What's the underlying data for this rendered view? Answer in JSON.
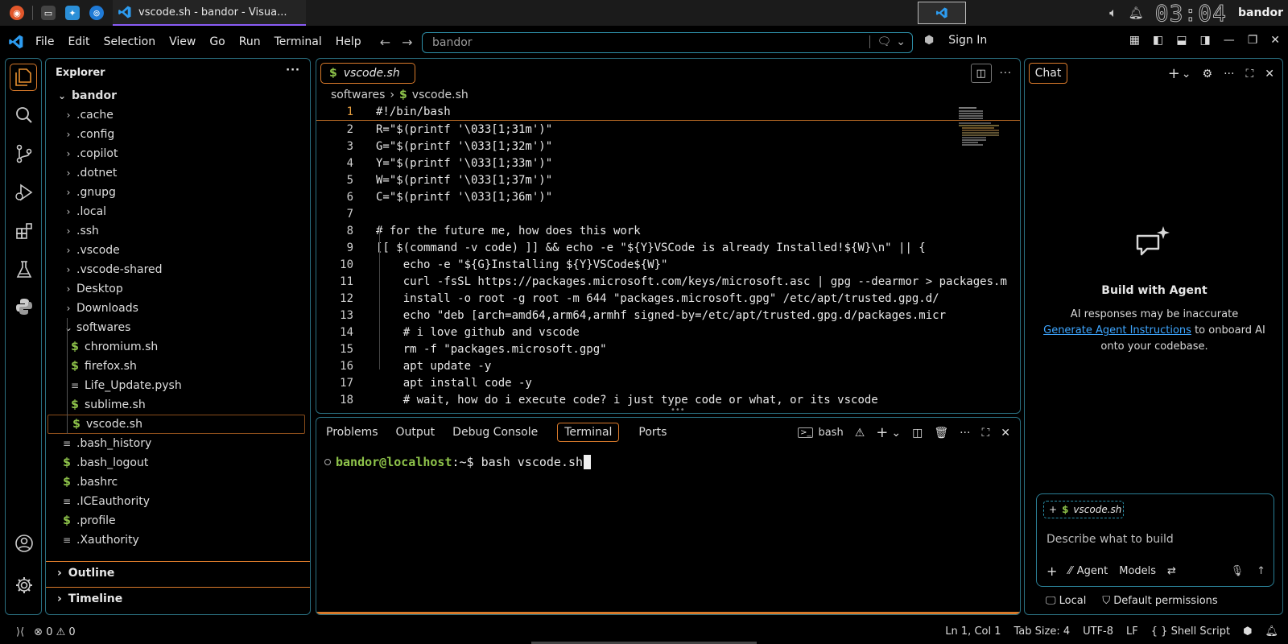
{
  "system": {
    "task_title": "vscode.sh - bandor - Visua...",
    "clock": "03:04",
    "user": "bandor"
  },
  "menu": [
    "File",
    "Edit",
    "Selection",
    "View",
    "Go",
    "Run",
    "Terminal",
    "Help"
  ],
  "command_center": {
    "text": "bandor"
  },
  "account": {
    "sign_in": "Sign In"
  },
  "explorer": {
    "title": "Explorer",
    "root": "bandor",
    "items": [
      {
        "label": ".cache",
        "type": "folder"
      },
      {
        "label": ".config",
        "type": "folder"
      },
      {
        "label": ".copilot",
        "type": "folder"
      },
      {
        "label": ".dotnet",
        "type": "folder"
      },
      {
        "label": ".gnupg",
        "type": "folder"
      },
      {
        "label": ".local",
        "type": "folder"
      },
      {
        "label": ".ssh",
        "type": "folder"
      },
      {
        "label": ".vscode",
        "type": "folder"
      },
      {
        "label": ".vscode-shared",
        "type": "folder"
      },
      {
        "label": "Desktop",
        "type": "folder"
      },
      {
        "label": "Downloads",
        "type": "folder"
      },
      {
        "label": "softwares",
        "type": "folder-open"
      },
      {
        "label": "chromium.sh",
        "type": "sh"
      },
      {
        "label": "firefox.sh",
        "type": "sh"
      },
      {
        "label": "Life_Update.pysh",
        "type": "txt"
      },
      {
        "label": "sublime.sh",
        "type": "sh"
      },
      {
        "label": "vscode.sh",
        "type": "sh"
      },
      {
        "label": ".bash_history",
        "type": "txt"
      },
      {
        "label": ".bash_logout",
        "type": "sh"
      },
      {
        "label": ".bashrc",
        "type": "sh"
      },
      {
        "label": ".ICEauthority",
        "type": "txt"
      },
      {
        "label": ".profile",
        "type": "sh"
      },
      {
        "label": ".Xauthority",
        "type": "txt"
      }
    ],
    "outline": "Outline",
    "timeline": "Timeline"
  },
  "editor": {
    "tab": "vscode.sh",
    "breadcrumb_folder": "softwares",
    "breadcrumb_file": "vscode.sh",
    "lines": [
      {
        "n": "1",
        "t": "#!/bin/bash",
        "cls": "cmt"
      },
      {
        "n": "2",
        "t": "R=\"$(printf '\\033[1;31m')\""
      },
      {
        "n": "3",
        "t": "G=\"$(printf '\\033[1;32m')\""
      },
      {
        "n": "4",
        "t": "Y=\"$(printf '\\033[1;33m')\""
      },
      {
        "n": "5",
        "t": "W=\"$(printf '\\033[1;37m')\""
      },
      {
        "n": "6",
        "t": "C=\"$(printf '\\033[1;36m')\""
      },
      {
        "n": "7",
        "t": ""
      },
      {
        "n": "8",
        "t": "# for the future me, how does this work",
        "cls": "cmt"
      },
      {
        "n": "9",
        "t": "[[ $(command -v code) ]] && echo -e \"${Y}VSCode is already Installed!${W}\\n\" || {"
      },
      {
        "n": "10",
        "t": "    echo -e \"${G}Installing ${Y}VSCode${W}\""
      },
      {
        "n": "11",
        "t": "    curl -fsSL https://packages.microsoft.com/keys/microsoft.asc | gpg --dearmor > packages.m"
      },
      {
        "n": "12",
        "t": "    install -o root -g root -m 644 \"packages.microsoft.gpg\" /etc/apt/trusted.gpg.d/"
      },
      {
        "n": "13",
        "t": "    echo \"deb [arch=amd64,arm64,armhf signed-by=/etc/apt/trusted.gpg.d/packages.micr"
      },
      {
        "n": "14",
        "t": "    # i love github and vscode",
        "cls": "cmt"
      },
      {
        "n": "15",
        "t": "    rm -f \"packages.microsoft.gpg\""
      },
      {
        "n": "16",
        "t": "    apt update -y"
      },
      {
        "n": "17",
        "t": "    apt install code -y"
      },
      {
        "n": "18",
        "t": "    # wait, how do i execute code? i just type code or what, or its vscode",
        "cls": "cmt"
      }
    ]
  },
  "panel": {
    "tabs": [
      "Problems",
      "Output",
      "Debug Console",
      "Terminal",
      "Ports"
    ],
    "shell": "bash",
    "prompt_user": "bandor@localhost",
    "prompt_path": ":~$ ",
    "command": "bash vscode.sh"
  },
  "chat": {
    "tab": "Chat",
    "title": "Build with Agent",
    "sub1": "AI responses may be inaccurate",
    "link": "Generate Agent Instructions",
    "sub2": " to onboard AI onto your codebase.",
    "context_file": "vscode.sh",
    "placeholder": "Describe what to build",
    "agent": "Agent",
    "models": "Models",
    "local": "Local",
    "permissions": "Default permissions"
  },
  "status": {
    "errors": "0",
    "warnings": "0",
    "position": "Ln 1, Col 1",
    "tab_size": "Tab Size: 4",
    "encoding": "UTF-8",
    "eol": "LF",
    "language": "Shell Script"
  }
}
